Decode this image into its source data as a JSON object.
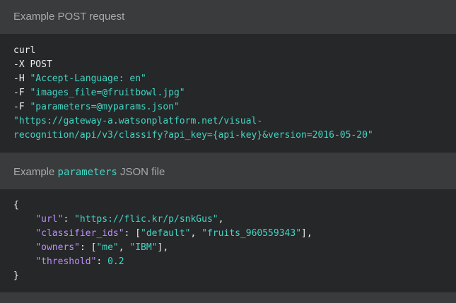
{
  "post_section": {
    "header": "Example POST request",
    "lines": [
      {
        "cmd": "curl",
        "arg": ""
      },
      {
        "cmd": "-X",
        "arg": "POST"
      },
      {
        "cmd": "-H",
        "arg": "\"Accept-Language: en\""
      },
      {
        "cmd": "-F",
        "arg": "\"images_file=@fruitbowl.jpg\""
      },
      {
        "cmd": "-F",
        "arg": "\"parameters=@myparams.json\""
      }
    ],
    "url_line1": "\"https://gateway-a.watsonplatform.net/visual-",
    "url_line2": "recognition/api/v3/classify?api_key={api-key}&version=2016-05-20\""
  },
  "params_section": {
    "header_prefix": "Example",
    "header_code": "parameters",
    "header_suffix": "JSON file",
    "open_brace": "{",
    "close_brace": "}",
    "url_key": "\"url\"",
    "url_value": "\"https://flic.kr/p/snkGus\"",
    "classifier_key": "\"classifier_ids\"",
    "classifier_values": [
      "\"default\"",
      "\"fruits_960559343\""
    ],
    "owners_key": "\"owners\"",
    "owners_values": [
      "\"me\"",
      "\"IBM\""
    ],
    "threshold_key": "\"threshold\"",
    "threshold_value": "0.2"
  },
  "colors": {
    "background": "#3a3b3d",
    "code_background": "#262729",
    "string": "#41d6c3",
    "key": "#ba8ff7",
    "header_text": "#a7a9ab"
  }
}
